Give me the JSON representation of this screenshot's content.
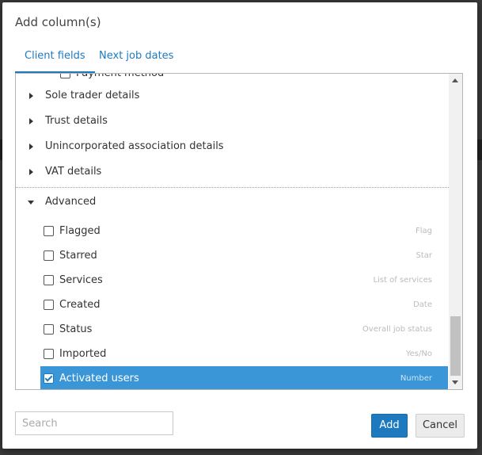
{
  "dialog": {
    "title": "Add column(s)"
  },
  "tabs": [
    {
      "label": "Client fields",
      "active": true
    },
    {
      "label": "Next job dates",
      "active": false
    }
  ],
  "partial_item": {
    "label": "Payment method"
  },
  "groups": [
    {
      "label": "Sole trader details",
      "expanded": false
    },
    {
      "label": "Trust details",
      "expanded": false
    },
    {
      "label": "Unincorporated association details",
      "expanded": false
    },
    {
      "label": "VAT details",
      "expanded": false
    },
    {
      "label": "Advanced",
      "expanded": true
    }
  ],
  "advanced_fields": [
    {
      "label": "Flagged",
      "type": "Flag",
      "checked": false
    },
    {
      "label": "Starred",
      "type": "Star",
      "checked": false
    },
    {
      "label": "Services",
      "type": "List of services",
      "checked": false
    },
    {
      "label": "Created",
      "type": "Date",
      "checked": false
    },
    {
      "label": "Status",
      "type": "Overall job status",
      "checked": false
    },
    {
      "label": "Imported",
      "type": "Yes/No",
      "checked": false
    },
    {
      "label": "Activated users",
      "type": "Number",
      "checked": true
    }
  ],
  "search": {
    "placeholder": "Search",
    "value": ""
  },
  "buttons": {
    "add": "Add",
    "cancel": "Cancel"
  },
  "colors": {
    "accent": "#1e7abf",
    "selected_row": "#3a96d7"
  }
}
